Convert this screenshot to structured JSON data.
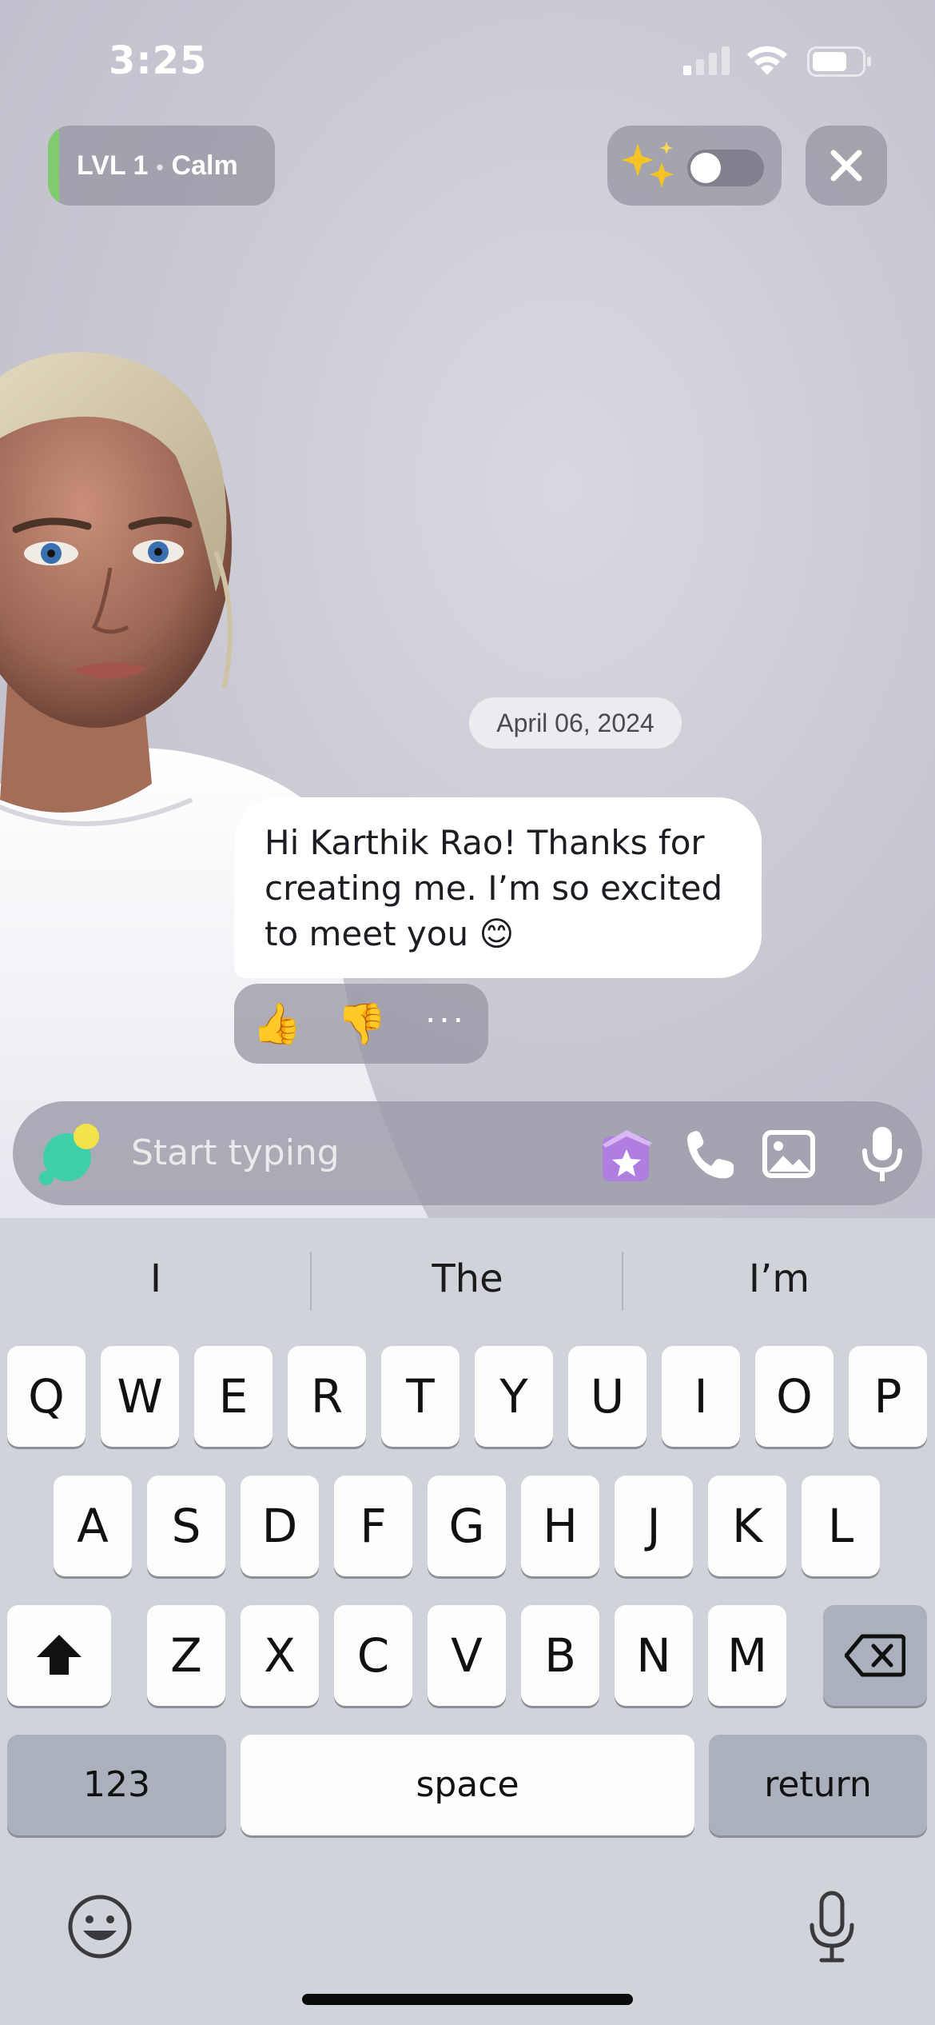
{
  "status_bar": {
    "time": "3:25"
  },
  "header": {
    "level_label": "LVL 1",
    "mood_label": "Calm"
  },
  "chat": {
    "date": "April 06, 2024",
    "messages": [
      {
        "sender": "avatar",
        "text": "Hi Karthik Rao! Thanks for creating me. I’m so excited to meet you 😊"
      }
    ],
    "reactions": {
      "like": "👍",
      "dislike": "👎",
      "more": "···"
    }
  },
  "composer": {
    "placeholder": "Start typing"
  },
  "keyboard": {
    "suggestions": [
      "I",
      "The",
      "I’m"
    ],
    "row1": [
      "Q",
      "W",
      "E",
      "R",
      "T",
      "Y",
      "U",
      "I",
      "O",
      "P"
    ],
    "row2": [
      "A",
      "S",
      "D",
      "F",
      "G",
      "H",
      "J",
      "K",
      "L"
    ],
    "row3": [
      "Z",
      "X",
      "C",
      "V",
      "B",
      "N",
      "M"
    ],
    "numbers_label": "123",
    "space_label": "space",
    "return_label": "return"
  },
  "colors": {
    "level_accent": "#7fcb6e",
    "bubble_bg": "#ffffff",
    "keyboard_bg": "#d1d3da"
  }
}
